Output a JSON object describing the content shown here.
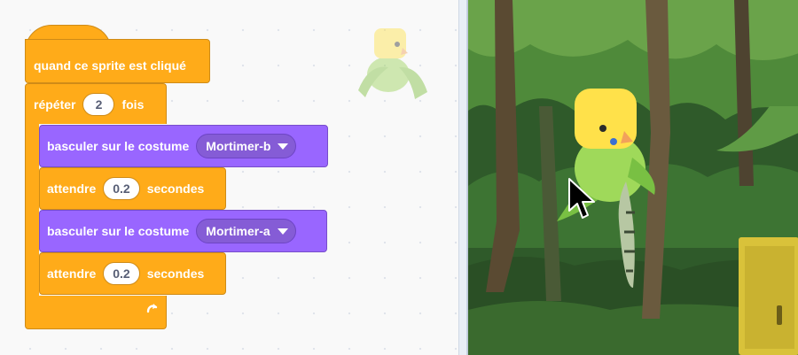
{
  "blocks": {
    "hat_label": "quand ce sprite est cliqué",
    "repeat_label": "répéter",
    "repeat_count": "2",
    "repeat_suffix": "fois",
    "switch_label": "basculer sur le costume",
    "costume_1": "Mortimer-b",
    "costume_2": "Mortimer-a",
    "wait_label": "attendre",
    "wait_value": "0.2",
    "wait_suffix": "secondes"
  },
  "colors": {
    "control": "#ffab19",
    "looks": "#9966ff",
    "looks_dropdown": "#855cd6"
  },
  "icons": {
    "loop": "loop-arrow-icon",
    "dropdown": "chevron-down-icon",
    "cursor": "mouse-pointer-icon"
  },
  "stage": {
    "sprite_name": "Mortimer",
    "backdrop": "forest"
  }
}
